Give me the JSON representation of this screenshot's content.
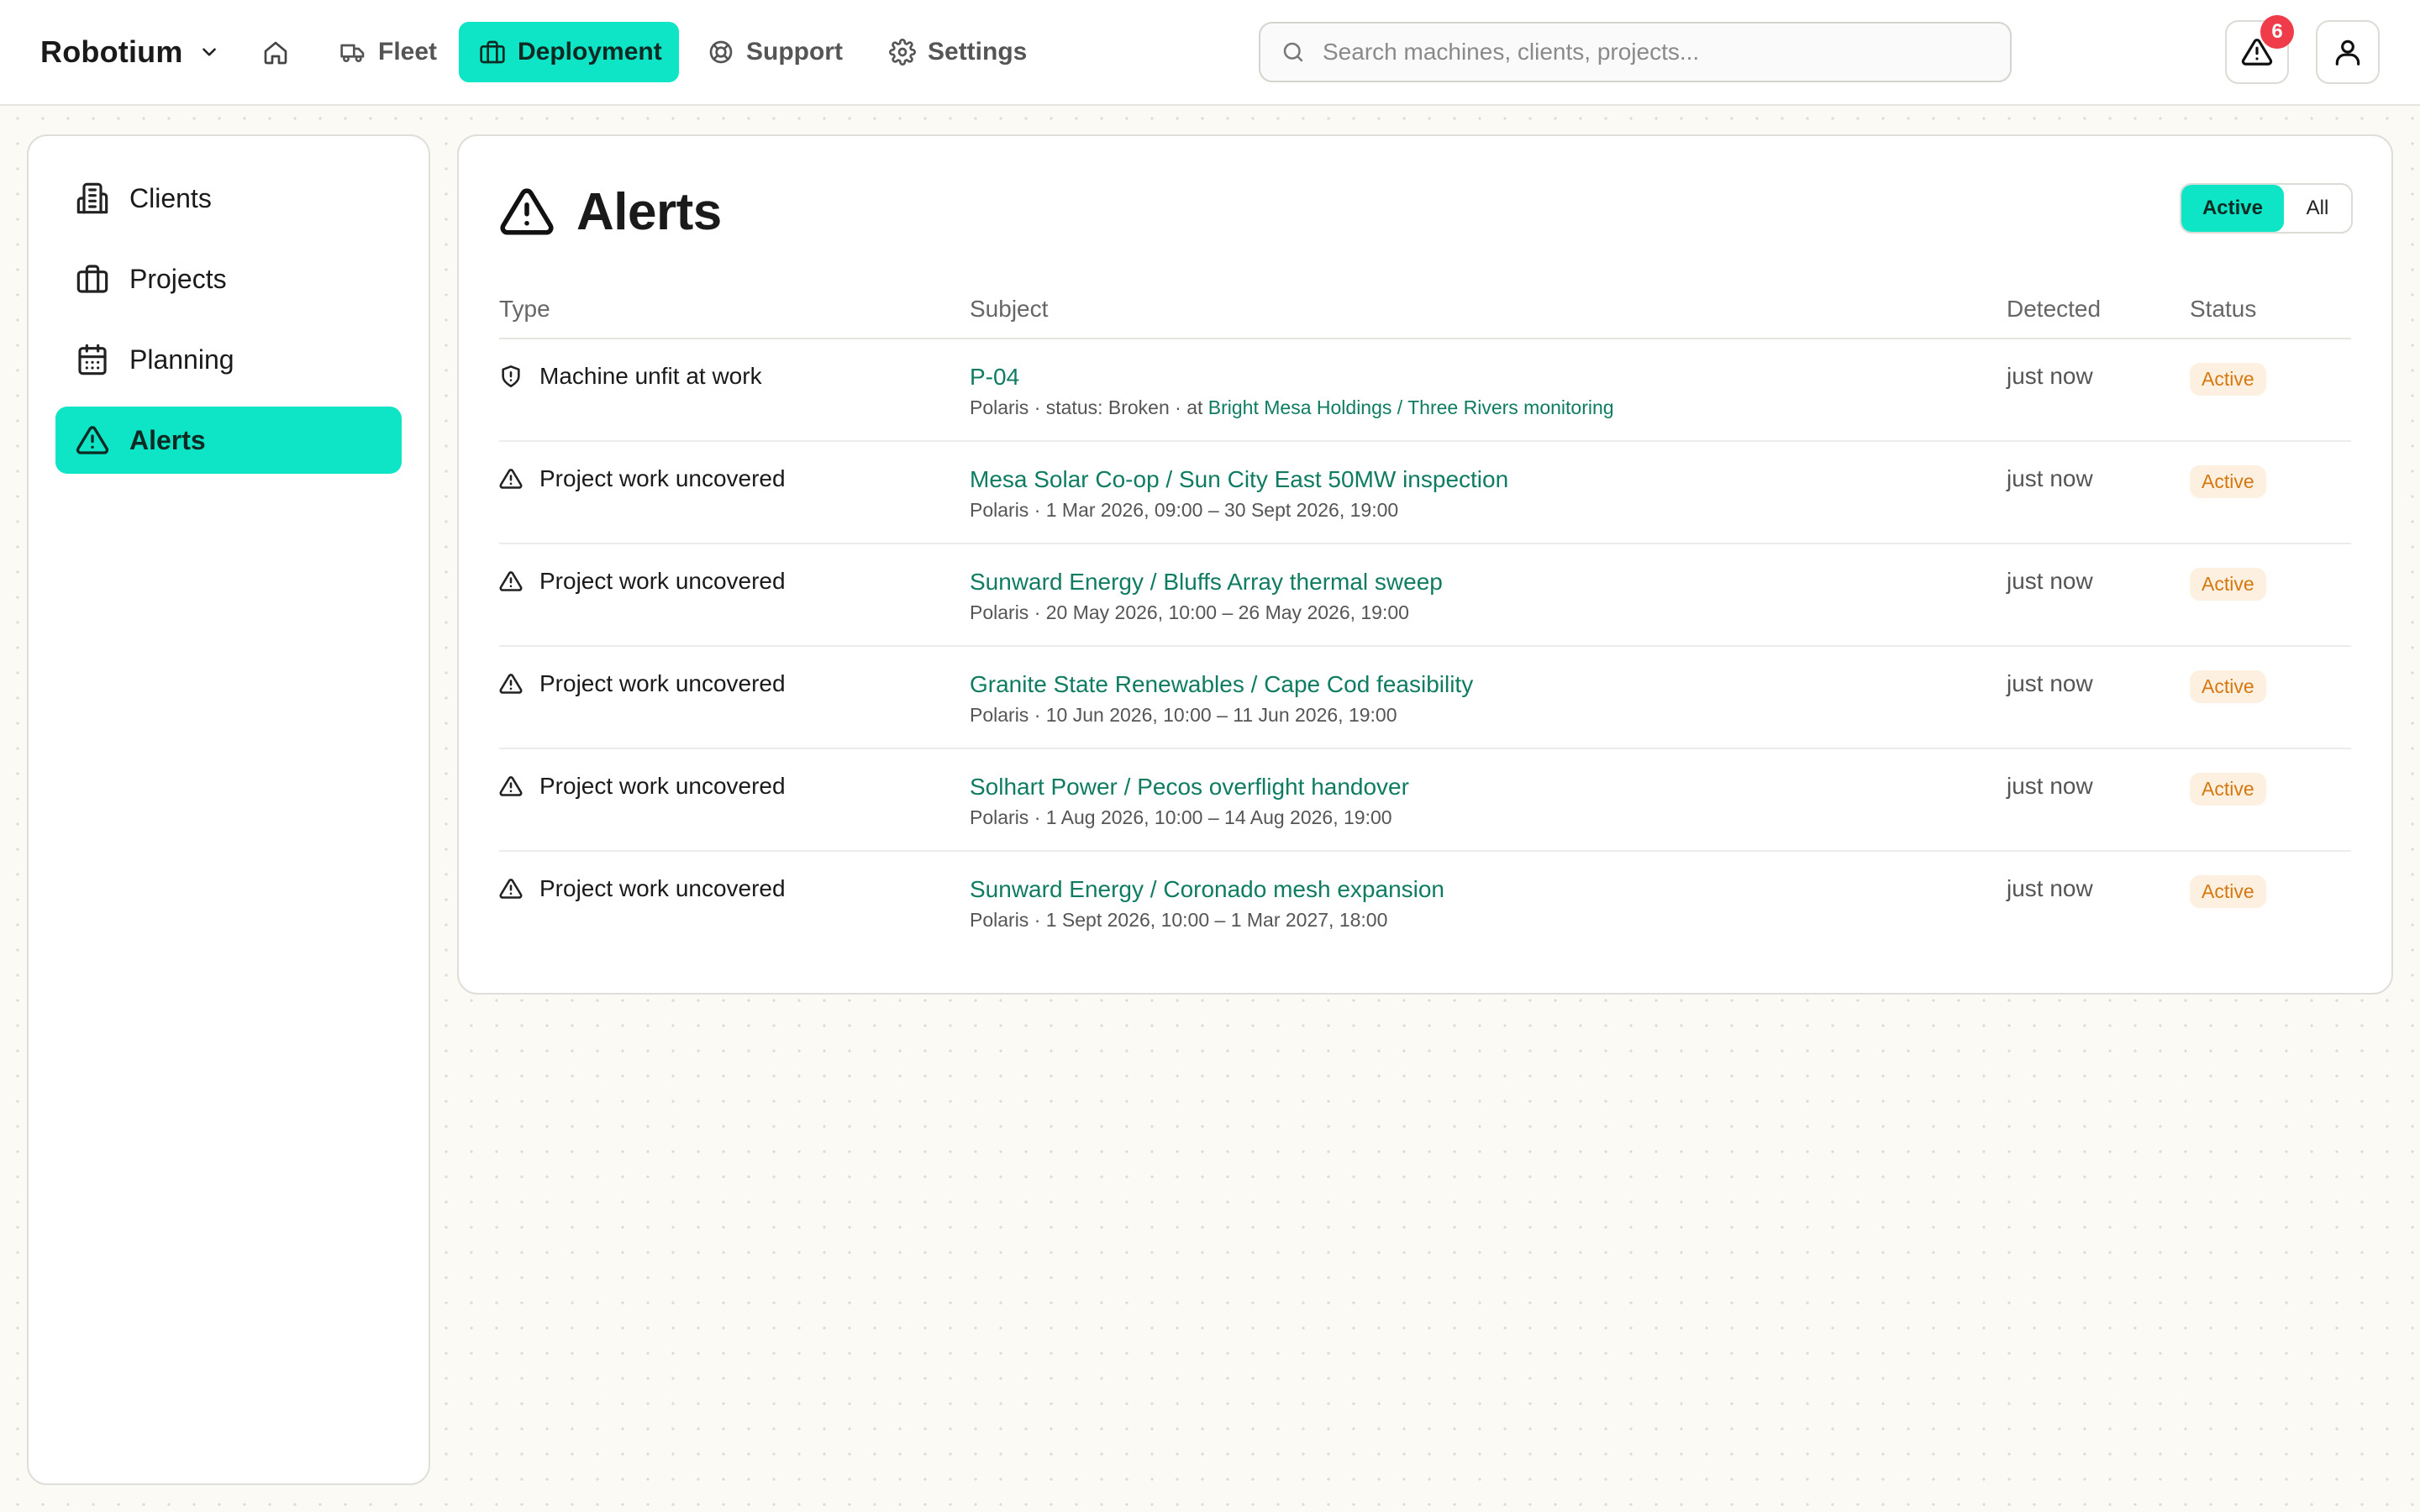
{
  "header": {
    "brand": "Robotium",
    "nav": [
      {
        "label": "Fleet",
        "icon": "truck-icon"
      },
      {
        "label": "Deployment",
        "icon": "briefcase-icon",
        "active": true
      },
      {
        "label": "Support",
        "icon": "lifebuoy-icon"
      },
      {
        "label": "Settings",
        "icon": "gear-icon"
      }
    ],
    "search_placeholder": "Search machines, clients, projects...",
    "alert_count": "6"
  },
  "sidebar": {
    "items": [
      {
        "label": "Clients",
        "icon": "building-icon"
      },
      {
        "label": "Projects",
        "icon": "briefcase-icon"
      },
      {
        "label": "Planning",
        "icon": "calendar-icon"
      },
      {
        "label": "Alerts",
        "icon": "warning-icon",
        "active": true
      }
    ]
  },
  "main": {
    "title": "Alerts",
    "filter": {
      "active_label": "Active",
      "all_label": "All",
      "selected": "Active"
    },
    "columns": {
      "type": "Type",
      "subject": "Subject",
      "detected": "Detected",
      "status": "Status"
    },
    "rows": [
      {
        "type": "Machine unfit at work",
        "icon": "shield-alert-icon",
        "subject": "P-04",
        "meta_prefix": "Polaris · status: Broken · at ",
        "meta_link": "Bright Mesa Holdings / Three Rivers monitoring",
        "detected": "just now",
        "status": "Active"
      },
      {
        "type": "Project work uncovered",
        "icon": "warning-icon",
        "subject": "Mesa Solar Co-op / Sun City East 50MW inspection",
        "meta_prefix": "Polaris · 1 Mar 2026, 09:00 – 30 Sept 2026, 19:00",
        "meta_link": "",
        "detected": "just now",
        "status": "Active"
      },
      {
        "type": "Project work uncovered",
        "icon": "warning-icon",
        "subject": "Sunward Energy / Bluffs Array thermal sweep",
        "meta_prefix": "Polaris · 20 May 2026, 10:00 – 26 May 2026, 19:00",
        "meta_link": "",
        "detected": "just now",
        "status": "Active"
      },
      {
        "type": "Project work uncovered",
        "icon": "warning-icon",
        "subject": "Granite State Renewables / Cape Cod feasibility",
        "meta_prefix": "Polaris · 10 Jun 2026, 10:00 – 11 Jun 2026, 19:00",
        "meta_link": "",
        "detected": "just now",
        "status": "Active"
      },
      {
        "type": "Project work uncovered",
        "icon": "warning-icon",
        "subject": "Solhart Power / Pecos overflight handover",
        "meta_prefix": "Polaris · 1 Aug 2026, 10:00 – 14 Aug 2026, 19:00",
        "meta_link": "",
        "detected": "just now",
        "status": "Active"
      },
      {
        "type": "Project work uncovered",
        "icon": "warning-icon",
        "subject": "Sunward Energy / Coronado mesh expansion",
        "meta_prefix": "Polaris · 1 Sept 2026, 10:00 – 1 Mar 2027, 18:00",
        "meta_link": "",
        "detected": "just now",
        "status": "Active"
      }
    ]
  },
  "colors": {
    "accent": "#0ee5c6",
    "link": "#0f7c62",
    "status_text": "#d4780f",
    "status_bg": "#fdf0e0",
    "badge": "#ef3b4a"
  }
}
